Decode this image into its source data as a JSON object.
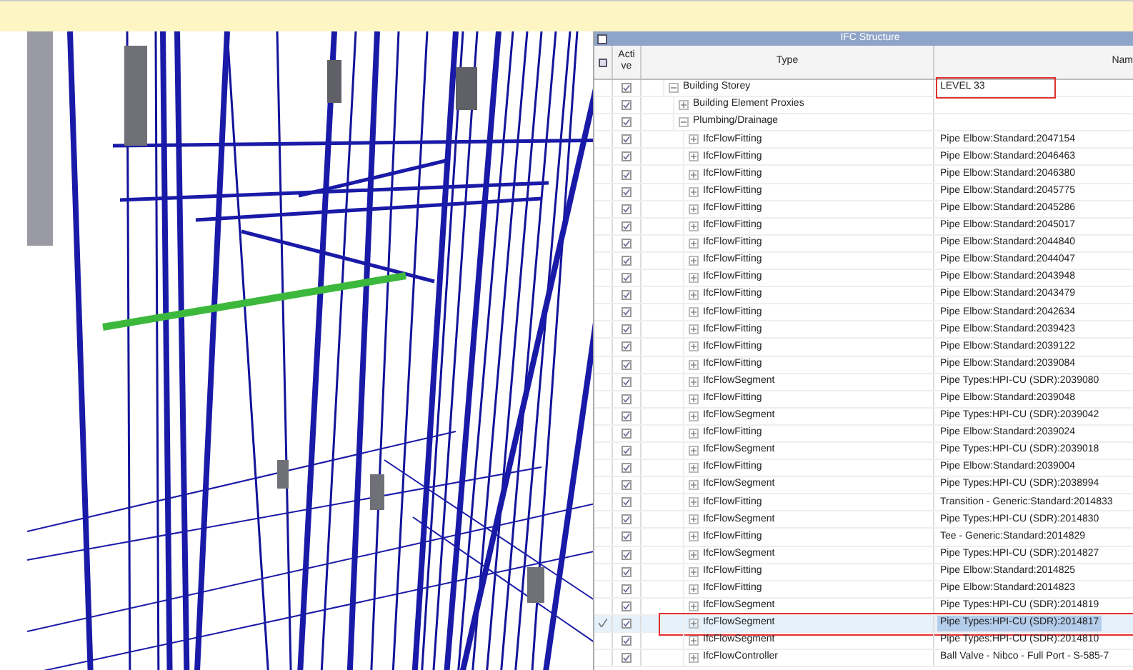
{
  "panel": {
    "title": "IFC Structure"
  },
  "columns": [
    "Acti ve",
    "Type",
    "Nam"
  ],
  "tree": [
    {
      "type": "Building Storey",
      "name": "LEVEL 33",
      "active": true,
      "expanded": true,
      "selected": false,
      "annotated": true,
      "children": [
        {
          "type": "Building Element Proxies",
          "active": true,
          "expanded": false,
          "selected": false,
          "annotated": false
        },
        {
          "type": "Plumbing/Drainage",
          "active": true,
          "expanded": true,
          "selected": false,
          "annotated": false,
          "children": [
            {
              "type": "IfcFlowFitting",
              "name": "Pipe Elbow:Standard:2047154",
              "active": true,
              "expanded": false,
              "selected": false,
              "annotated": false
            },
            {
              "type": "IfcFlowFitting",
              "name": "Pipe Elbow:Standard:2046463",
              "active": true,
              "expanded": false,
              "selected": false,
              "annotated": false
            },
            {
              "type": "IfcFlowFitting",
              "name": "Pipe Elbow:Standard:2046380",
              "active": true,
              "expanded": false,
              "selected": false,
              "annotated": false
            },
            {
              "type": "IfcFlowFitting",
              "name": "Pipe Elbow:Standard:2045775",
              "active": true,
              "expanded": false,
              "selected": false,
              "annotated": false
            },
            {
              "type": "IfcFlowFitting",
              "name": "Pipe Elbow:Standard:2045286",
              "active": true,
              "expanded": false,
              "selected": false,
              "annotated": false
            },
            {
              "type": "IfcFlowFitting",
              "name": "Pipe Elbow:Standard:2045017",
              "active": true,
              "expanded": false,
              "selected": false,
              "annotated": false
            },
            {
              "type": "IfcFlowFitting",
              "name": "Pipe Elbow:Standard:2044840",
              "active": true,
              "expanded": false,
              "selected": false,
              "annotated": false
            },
            {
              "type": "IfcFlowFitting",
              "name": "Pipe Elbow:Standard:2044047",
              "active": true,
              "expanded": false,
              "selected": false,
              "annotated": false
            },
            {
              "type": "IfcFlowFitting",
              "name": "Pipe Elbow:Standard:2043948",
              "active": true,
              "expanded": false,
              "selected": false,
              "annotated": false
            },
            {
              "type": "IfcFlowFitting",
              "name": "Pipe Elbow:Standard:2043479",
              "active": true,
              "expanded": false,
              "selected": false,
              "annotated": false
            },
            {
              "type": "IfcFlowFitting",
              "name": "Pipe Elbow:Standard:2042634",
              "active": true,
              "expanded": false,
              "selected": false,
              "annotated": false
            },
            {
              "type": "IfcFlowFitting",
              "name": "Pipe Elbow:Standard:2039423",
              "active": true,
              "expanded": false,
              "selected": false,
              "annotated": false
            },
            {
              "type": "IfcFlowFitting",
              "name": "Pipe Elbow:Standard:2039122",
              "active": true,
              "expanded": false,
              "selected": false,
              "annotated": false
            },
            {
              "type": "IfcFlowFitting",
              "name": "Pipe Elbow:Standard:2039084",
              "active": true,
              "expanded": false,
              "selected": false,
              "annotated": false
            },
            {
              "type": "IfcFlowSegment",
              "name": "Pipe Types:HPI-CU (SDR):2039080",
              "active": true,
              "expanded": false,
              "selected": false,
              "annotated": false
            },
            {
              "type": "IfcFlowFitting",
              "name": "Pipe Elbow:Standard:2039048",
              "active": true,
              "expanded": false,
              "selected": false,
              "annotated": false
            },
            {
              "type": "IfcFlowSegment",
              "name": "Pipe Types:HPI-CU (SDR):2039042",
              "active": true,
              "expanded": false,
              "selected": false,
              "annotated": false
            },
            {
              "type": "IfcFlowFitting",
              "name": "Pipe Elbow:Standard:2039024",
              "active": true,
              "expanded": false,
              "selected": false,
              "annotated": false
            },
            {
              "type": "IfcFlowSegment",
              "name": "Pipe Types:HPI-CU (SDR):2039018",
              "active": true,
              "expanded": false,
              "selected": false,
              "annotated": false
            },
            {
              "type": "IfcFlowFitting",
              "name": "Pipe Elbow:Standard:2039004",
              "active": true,
              "expanded": false,
              "selected": false,
              "annotated": false
            },
            {
              "type": "IfcFlowSegment",
              "name": "Pipe Types:HPI-CU (SDR):2038994",
              "active": true,
              "expanded": false,
              "selected": false,
              "annotated": false
            },
            {
              "type": "IfcFlowFitting",
              "name": "Transition - Generic:Standard:2014833",
              "active": true,
              "expanded": false,
              "selected": false,
              "annotated": false
            },
            {
              "type": "IfcFlowSegment",
              "name": "Pipe Types:HPI-CU (SDR):2014830",
              "active": true,
              "expanded": false,
              "selected": false,
              "annotated": false
            },
            {
              "type": "IfcFlowFitting",
              "name": "Tee - Generic:Standard:2014829",
              "active": true,
              "expanded": false,
              "selected": false,
              "annotated": false
            },
            {
              "type": "IfcFlowSegment",
              "name": "Pipe Types:HPI-CU (SDR):2014827",
              "active": true,
              "expanded": false,
              "selected": false,
              "annotated": false
            },
            {
              "type": "IfcFlowFitting",
              "name": "Pipe Elbow:Standard:2014825",
              "active": true,
              "expanded": false,
              "selected": false,
              "annotated": false
            },
            {
              "type": "IfcFlowFitting",
              "name": "Pipe Elbow:Standard:2014823",
              "active": true,
              "expanded": false,
              "selected": false,
              "annotated": false
            },
            {
              "type": "IfcFlowSegment",
              "name": "Pipe Types:HPI-CU (SDR):2014819",
              "active": true,
              "expanded": false,
              "selected": false,
              "annotated": false
            },
            {
              "type": "IfcFlowSegment",
              "name": "Pipe Types:HPI-CU (SDR):2014817",
              "active": true,
              "expanded": false,
              "selected": true,
              "annotated": true
            },
            {
              "type": "IfcFlowSegment",
              "name": "Pipe Types:HPI-CU (SDR):2014810",
              "active": true,
              "expanded": false,
              "selected": false,
              "annotated": false
            },
            {
              "type": "IfcFlowController",
              "name": "Ball Valve - Nibco - Full Port - S-585-7",
              "active": true,
              "expanded": false,
              "selected": false,
              "annotated": false
            }
          ]
        }
      ]
    }
  ]
}
